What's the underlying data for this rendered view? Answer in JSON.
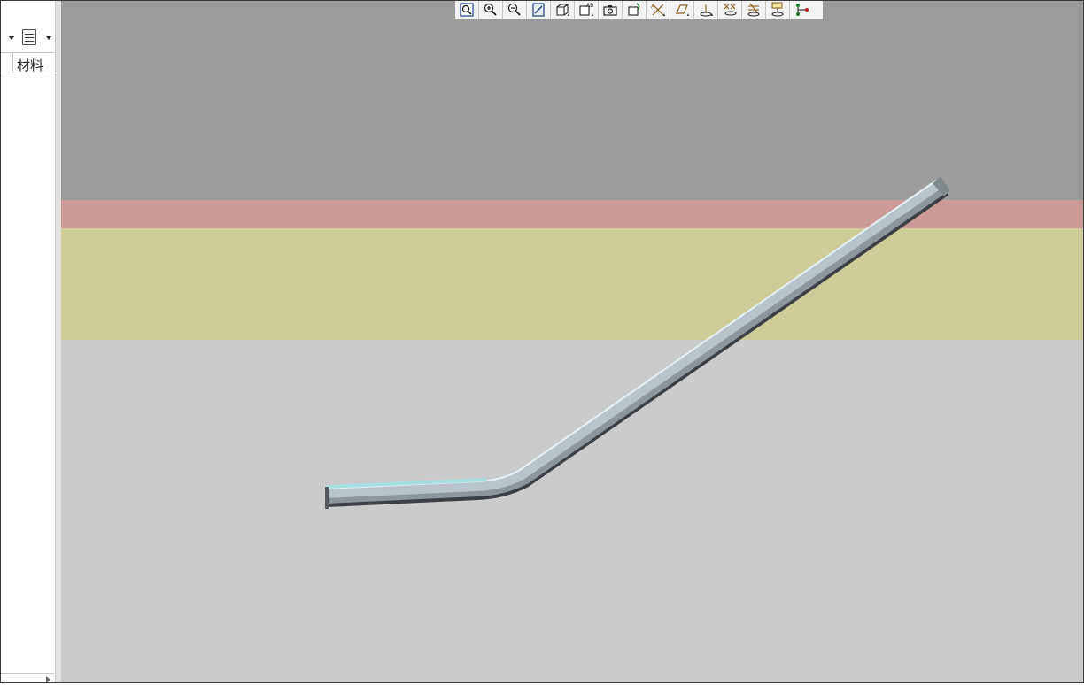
{
  "left_panel": {
    "column_header": "材料",
    "view_dropdown_icon": "list-view-icon",
    "arrow_icon": "chevron-down-icon"
  },
  "viewport": {
    "background_bands": [
      {
        "name": "upper",
        "color": "#9c9c9c"
      },
      {
        "name": "red",
        "color": "#cd9a9a"
      },
      {
        "name": "yellow",
        "color": "#cecd99"
      },
      {
        "name": "lower",
        "color": "#cbcbcb"
      }
    ],
    "model": "bent-tube",
    "model_color": "#b9c4ca",
    "highlight_color": "#a6dfe0"
  },
  "toolbar": {
    "buttons": [
      {
        "icon": "zoom-fit-icon"
      },
      {
        "icon": "zoom-in-icon"
      },
      {
        "icon": "zoom-out-icon"
      },
      {
        "icon": "repaint-icon"
      },
      {
        "icon": "view-orientation-icon"
      },
      {
        "icon": "saved-views-icon"
      },
      {
        "icon": "camera-icon"
      },
      {
        "icon": "spin-center-icon"
      },
      {
        "icon": "datum-axes-display-icon"
      },
      {
        "icon": "datum-planes-display-icon"
      },
      {
        "icon": "datum-points-display-icon"
      },
      {
        "icon": "coordinate-systems-display-icon"
      },
      {
        "icon": "annotations-display-icon"
      },
      {
        "icon": "spin-display-icon"
      },
      {
        "icon": "network-display-icon"
      }
    ]
  }
}
